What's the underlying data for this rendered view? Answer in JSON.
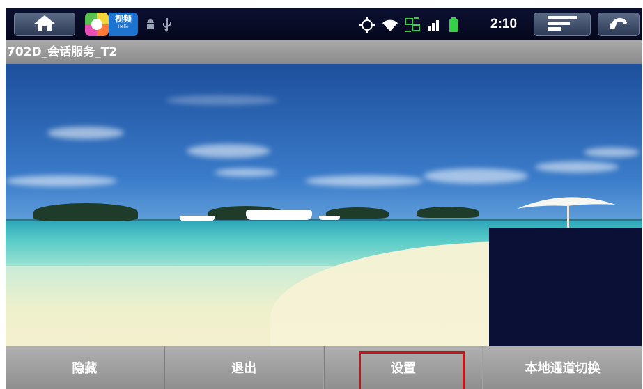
{
  "status_bar": {
    "time": "2:10",
    "app_icon_label": "视频",
    "app_icon_sublabel": "Hello",
    "icons": [
      "home-icon",
      "android-icon",
      "usb-icon",
      "gps-icon",
      "wifi-icon",
      "sync-icon",
      "signal-icon",
      "battery-icon",
      "menu-icon",
      "back-icon"
    ],
    "accent": "#0b1030"
  },
  "title_bar": {
    "title": "702D_会话服务_T2"
  },
  "bottom_bar": {
    "buttons": [
      {
        "label": "隐藏"
      },
      {
        "label": "退出"
      },
      {
        "label": "设置"
      },
      {
        "label": "本地通道切换"
      }
    ],
    "highlight_color": "#c01818"
  },
  "preview": {
    "background": "#0b1036"
  }
}
